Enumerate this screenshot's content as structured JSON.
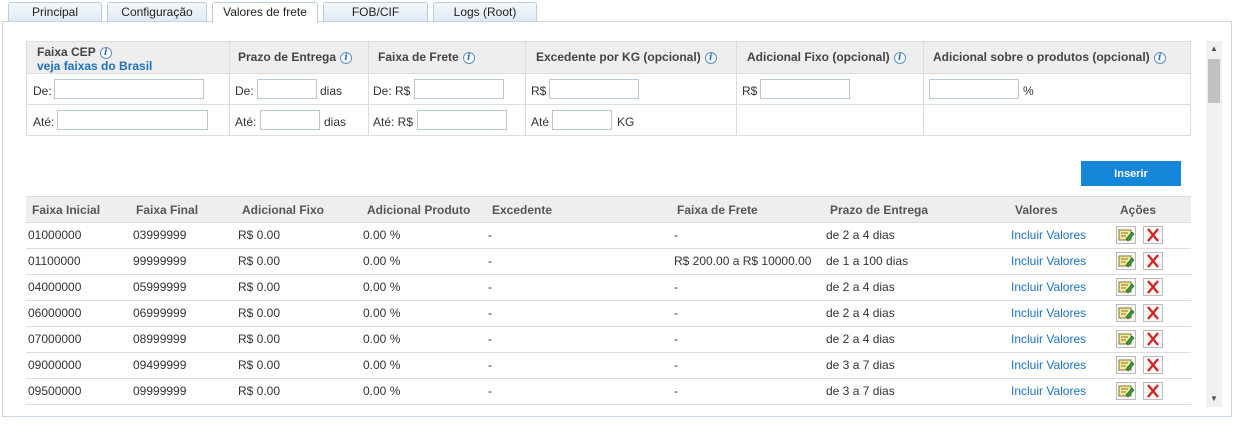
{
  "tabs": [
    {
      "label": "Principal",
      "active": false
    },
    {
      "label": "Configuração",
      "active": false
    },
    {
      "label": "Valores de frete",
      "active": true
    },
    {
      "label": "FOB/CIF",
      "active": false
    },
    {
      "label": "Logs (Root)",
      "active": false
    }
  ],
  "form": {
    "faixa_cep": {
      "title": "Faixa CEP",
      "link": "veja faixas do Brasil",
      "from_label": "De:",
      "to_label": "Até:",
      "from_value": "",
      "to_value": ""
    },
    "prazo": {
      "title": "Prazo de Entrega",
      "from_label": "De:",
      "to_label": "Até:",
      "unit": "dias",
      "from_value": "",
      "to_value": ""
    },
    "faixa_frete": {
      "title": "Faixa de Frete",
      "from_label": "De: R$",
      "to_label": "Até: R$",
      "from_value": "",
      "to_value": ""
    },
    "excedente": {
      "title": "Excedente por KG (opcional)",
      "from_label": "R$",
      "to_label": "Até",
      "unit": "KG",
      "from_value": "",
      "to_value": ""
    },
    "adicional_fixo": {
      "title": "Adicional Fixo (opcional)",
      "label": "R$",
      "value": ""
    },
    "adicional_produtos": {
      "title": "Adicional sobre o produtos (opcional)",
      "unit": "%",
      "value": ""
    },
    "info_icon": "info-icon",
    "insert_label": "Inserir"
  },
  "table": {
    "headers": [
      "Faixa Inicial",
      "Faixa Final",
      "Adicional Fixo",
      "Adicional Produto",
      "Excedente",
      "Faixa de Frete",
      "Prazo de Entrega",
      "Valores",
      "Ações"
    ],
    "rows": [
      {
        "inicial": "01000000",
        "final": "03999999",
        "fixo": "R$ 0.00",
        "produto": "0.00 %",
        "excedente": "-",
        "frete": "-",
        "prazo": "de 2 a 4 dias",
        "valores": "Incluir Valores"
      },
      {
        "inicial": "01100000",
        "final": "99999999",
        "fixo": "R$ 0.00",
        "produto": "0.00 %",
        "excedente": "-",
        "frete": "R$ 200.00 a R$ 10000.00",
        "prazo": "de 1 a 100 dias",
        "valores": "Incluir Valores"
      },
      {
        "inicial": "04000000",
        "final": "05999999",
        "fixo": "R$ 0.00",
        "produto": "0.00 %",
        "excedente": "-",
        "frete": "-",
        "prazo": "de 2 a 4 dias",
        "valores": "Incluir Valores"
      },
      {
        "inicial": "06000000",
        "final": "06999999",
        "fixo": "R$ 0.00",
        "produto": "0.00 %",
        "excedente": "-",
        "frete": "-",
        "prazo": "de 2 a 4 dias",
        "valores": "Incluir Valores"
      },
      {
        "inicial": "07000000",
        "final": "08999999",
        "fixo": "R$ 0.00",
        "produto": "0.00 %",
        "excedente": "-",
        "frete": "-",
        "prazo": "de 2 a 4 dias",
        "valores": "Incluir Valores"
      },
      {
        "inicial": "09000000",
        "final": "09499999",
        "fixo": "R$ 0.00",
        "produto": "0.00 %",
        "excedente": "-",
        "frete": "-",
        "prazo": "de 3 a 7 dias",
        "valores": "Incluir Valores"
      },
      {
        "inicial": "09500000",
        "final": "09999999",
        "fixo": "R$ 0.00",
        "produto": "0.00 %",
        "excedente": "-",
        "frete": "-",
        "prazo": "de 3 a 7 dias",
        "valores": "Incluir Valores"
      }
    ],
    "edit_icon": "edit-icon",
    "delete_icon": "delete-icon"
  },
  "colors": {
    "accent": "#1686d8",
    "link": "#1b72c0",
    "delete": "#d42020"
  }
}
